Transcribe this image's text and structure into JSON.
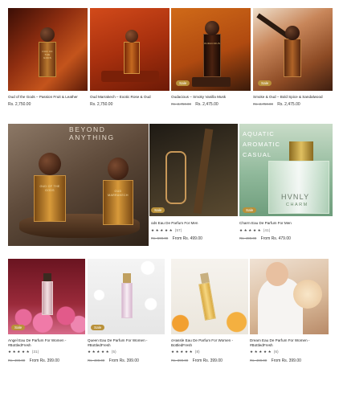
{
  "products": [
    {
      "title": "Oud of the Gods – Passion Fruit & Leather",
      "price": "Rs. 2,750.00",
      "old_price": "",
      "badge": "",
      "rating": "",
      "reviews": "",
      "bottle_label": "OUD OF THE GODS",
      "img_bg": "#a94a1a"
    },
    {
      "title": "Oud Marrakech – Exotic Rose & Oud",
      "price": "Rs. 2,750.00",
      "old_price": "",
      "badge": "",
      "rating": "",
      "reviews": "",
      "bottle_label": "OUD MARRAKECH",
      "img_bg": "#c2431a"
    },
    {
      "title": "Oudacious – Smoky Vanilla Musk",
      "price": "Rs. 2,475.00",
      "old_price": "Rs. 2,750.00",
      "badge": "Sale",
      "rating": "",
      "reviews": "",
      "bottle_label": "OUDACIOUS",
      "img_bg": "#c0560f"
    },
    {
      "title": "Smoke & Oud – Bold Spice & Sandalwood",
      "price": "Rs. 2,475.00",
      "old_price": "Rs. 2,750.00",
      "badge": "Sale",
      "rating": "",
      "reviews": "",
      "bottle_label": "",
      "img_bg": "#b56a3a"
    },
    {
      "title": "",
      "price": "",
      "old_price": "",
      "badge": "",
      "rating": "",
      "reviews": "",
      "overlay_text": "BEYOND ANYTHING",
      "label_left": "OUD OF THE GODS",
      "label_right": "OUD MARRAKECH",
      "img_bg": "#5a4636"
    },
    {
      "title": "ods Eau De Parfum For Men",
      "price": "From Rs. 499.00",
      "old_price": "Rs. 599.00",
      "badge": "Sale",
      "rating": "★ ★ ★ ★ ★",
      "reviews": "(57)",
      "img_bg": "#2e2a22"
    },
    {
      "title": "Charm Eau De Parfum For Men",
      "price": "From Rs. 479.00",
      "old_price": "Rs. 499.00",
      "badge": "Sale",
      "rating": "★ ★ ★ ★ ★",
      "reviews": "(41)",
      "overlay_lines": [
        "AQUATIC",
        "AROMATIC",
        "CASUAL"
      ],
      "brand": "HVNLY",
      "brand_sub": "CHARM",
      "img_bg": "#9fc3a8"
    },
    {
      "title": "Angel Eau De Parfum For Women - #BottledFresh",
      "price": "From Rs. 399.00",
      "old_price": "Rs. 499.00",
      "badge": "Sale",
      "rating": "★ ★ ★ ★ ★",
      "reviews": "(31)",
      "img_bg": "#7a1d2a"
    },
    {
      "title": "Queen Eau De Parfum For Women - #BottledFresh",
      "price": "From Rs. 399.00",
      "old_price": "Rs. 499.00",
      "badge": "Sale",
      "rating": "★ ★ ★ ★ ★",
      "reviews": "(5)",
      "img_bg": "#ececec"
    },
    {
      "title": "cHassle Eau De Parfum For Women - BottledFresh",
      "price": "From Rs. 399.00",
      "old_price": "Rs. 399.00",
      "badge": "",
      "rating": "★ ★ ★ ★ ★",
      "reviews": "(8)",
      "img_bg": "#f3f0ea"
    },
    {
      "title": "Dream Eau De Parfum For Women - #BottledFresh",
      "price": "From Rs. 399.00",
      "old_price": "Rs. 499.00",
      "badge": "",
      "rating": "★ ★ ★ ★ ★",
      "reviews": "(6)",
      "img_bg": "#d9b79a"
    }
  ]
}
